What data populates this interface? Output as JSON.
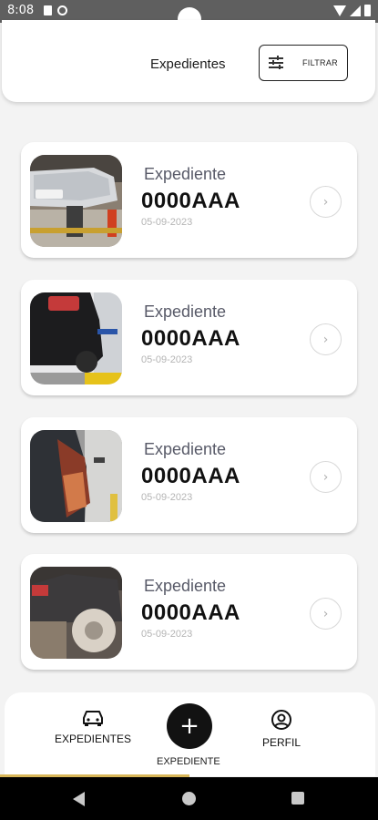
{
  "status_bar": {
    "time": "8:08",
    "icons": [
      "sim-icon",
      "at-icon",
      "wifi-icon",
      "signal-icon",
      "battery-icon"
    ]
  },
  "header": {
    "title": "Expedientes",
    "filter_button": {
      "label": "FILTRAR",
      "icon": "sliders-icon"
    }
  },
  "cards": [
    {
      "label": "Expediente",
      "code": "0000AAA",
      "date": "05-09-2023",
      "image": "car-lifted-front"
    },
    {
      "label": "Expediente",
      "code": "0000AAA",
      "date": "05-09-2023",
      "image": "car-on-lift-rear"
    },
    {
      "label": "Expediente",
      "code": "0000AAA",
      "date": "05-09-2023",
      "image": "car-open-door"
    },
    {
      "label": "Expediente",
      "code": "0000AAA",
      "date": "05-09-2023",
      "image": "car-wheel-removed"
    }
  ],
  "bottom_nav": {
    "expedientes": {
      "label": "EXPEDIENTES",
      "icon": "car-icon"
    },
    "add": {
      "label": "EXPEDIENTE",
      "icon": "plus-icon"
    },
    "perfil": {
      "label": "PERFIL",
      "icon": "user-circle-icon"
    }
  },
  "colors": {
    "background": "#f3f3f3",
    "card": "#ffffff",
    "fab": "#121212",
    "accent": "#d8b658",
    "status_bar": "#5f5f5f"
  }
}
